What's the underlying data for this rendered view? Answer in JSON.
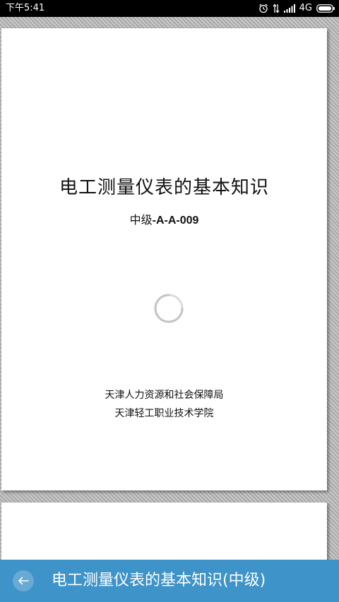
{
  "status_bar": {
    "time": "下午5:41",
    "network": "4G",
    "icons": [
      "alarm-icon",
      "data-transfer-icon",
      "signal-icon",
      "battery-icon"
    ]
  },
  "document": {
    "title": "电工测量仪表的基本知识",
    "code_prefix": "中级",
    "code_value": "-A-A-009",
    "org_line_1": "天津人力资源和社会保障局",
    "org_line_2": "天津轻工职业技术学院",
    "loading_icon": "loading-spinner-icon"
  },
  "bottom_bar": {
    "back_icon": "back-arrow-icon",
    "title": "电工测量仪表的基本知识(中级)",
    "color": "#3e93c8"
  }
}
